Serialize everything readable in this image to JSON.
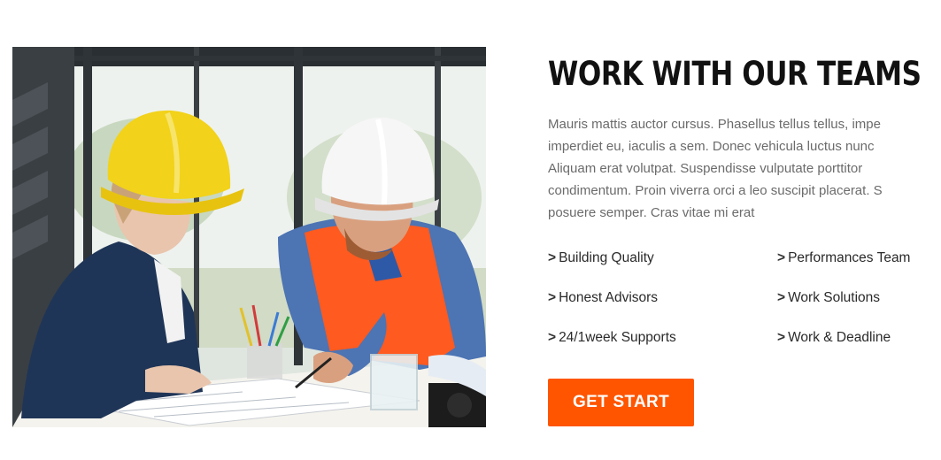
{
  "image": {
    "alt": "",
    "subject": "two-engineers-reviewing-blueprints"
  },
  "section": {
    "title": "WORK WITH OUR TEAMS",
    "paragraph_lines": [
      "Mauris mattis auctor cursus. Phasellus tellus tellus, impe",
      "imperdiet eu, iaculis a sem. Donec vehicula luctus nunc",
      "Aliquam erat volutpat. Suspendisse vulputate porttitor",
      "condimentum. Proin viverra orci a leo suscipit placerat. S",
      "posuere semper. Cras vitae mi erat"
    ],
    "bullet_glyph": ">",
    "features": [
      {
        "label": "Building Quality"
      },
      {
        "label": "Performances Team"
      },
      {
        "label": "Honest Advisors"
      },
      {
        "label": "Work Solutions"
      },
      {
        "label": "24/1week Supports"
      },
      {
        "label": "Work & Deadline"
      }
    ],
    "cta_label": "GET START"
  },
  "colors": {
    "accent": "#ff5500",
    "heading": "#111111",
    "body_text": "#6b6b6b",
    "feature_text": "#2a2a2a",
    "background": "#ffffff"
  }
}
